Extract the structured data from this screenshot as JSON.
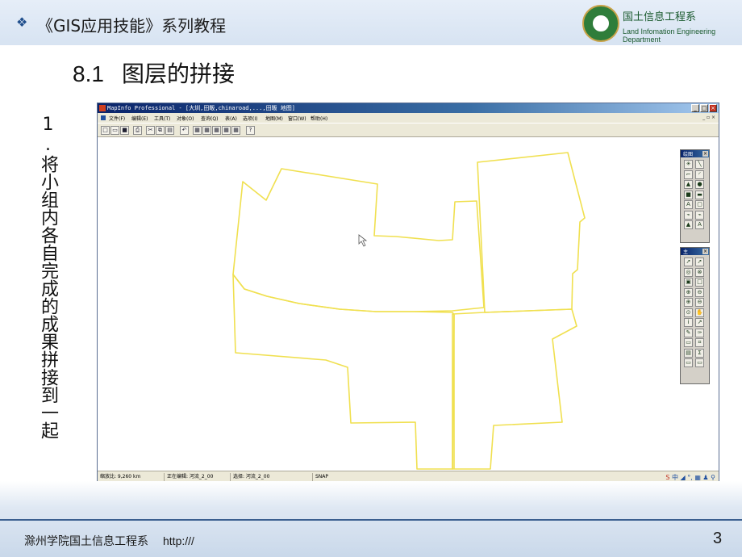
{
  "slide": {
    "header_title": "《GIS应用技能》系列教程",
    "header_bullet": "❖",
    "dept_cn": "国土信息工程系",
    "dept_en": "Land Infomation Engineering Department",
    "section_number": "8.1",
    "section_title": "图层的拼接",
    "vertical_caption": "1.将小组内各自完成的成果拼接到一起",
    "footer_left": "滁州学院国土信息工程系",
    "footer_url": "http:///",
    "page_number": "3",
    "colors": {
      "header_bg": "#d7e3f2",
      "footer_line": "#3b5f8f",
      "logo_green": "#2f7d3a"
    }
  },
  "app": {
    "title": "MapInfo Professional - [大圳,田畈,chinaroad,...,田畈 地图]",
    "menu": [
      "文件(F)",
      "编辑(E)",
      "工具(T)",
      "对象(O)",
      "查询(Q)",
      "表(A)",
      "选项(I)",
      "地图(M)",
      "窗口(W)",
      "帮助(H)"
    ],
    "doc_controls": "_ ▫ ×",
    "window_buttons": {
      "minimize": "_",
      "maximize": "□",
      "close": "×"
    },
    "toolbar_icons": [
      "new-icon",
      "open-icon",
      "save-icon",
      "print-icon",
      "cut-icon",
      "copy-icon",
      "paste-icon",
      "undo-icon",
      "mapper-icon",
      "browser-icon",
      "graph-icon",
      "layout-icon",
      "redistrict-icon",
      "help-icon"
    ],
    "toolbar_glyphs": [
      "□",
      "▭",
      "■",
      "⎙",
      "✂",
      "⧉",
      "▤",
      "↶",
      "▦",
      "▦",
      "▦",
      "▦",
      "▦",
      "?"
    ],
    "drawing_palette": {
      "title": "绘图",
      "icons": [
        "symbol-icon",
        "line-icon",
        "polyline-icon",
        "arc-icon",
        "polygon-icon",
        "ellipse-icon",
        "rectangle-icon",
        "rounded-rect-icon",
        "text-icon",
        "frame-icon",
        "reshape-icon",
        "add-node-icon",
        "region-style-icon",
        "text-style-icon"
      ],
      "glyphs": [
        "✳",
        "╲",
        "⌐",
        "◜",
        "▲",
        "●",
        "■",
        "▬",
        "A",
        "▢",
        "⌁",
        "⌁",
        "▲",
        "A"
      ]
    },
    "main_palette": {
      "title": "主",
      "icons": [
        "select-icon",
        "marquee-icon",
        "radius-select-icon",
        "boundary-select-icon",
        "polygon-select-icon",
        "unselect-icon",
        "graph-select-icon",
        "invert-icon",
        "zoom-in-icon",
        "zoom-out-icon",
        "change-view-icon",
        "grabber-icon",
        "info-icon",
        "hotlink-icon",
        "label-icon",
        "drag-window-icon",
        "layer-control-icon",
        "ruler-icon",
        "legend-icon",
        "statistics-icon",
        "clip-icon",
        "thematic-icon"
      ],
      "glyphs": [
        "➚",
        "➚",
        "◎",
        "⊗",
        "▣",
        "□",
        "⊕",
        "⊖",
        "⊕",
        "⊖",
        "⊙",
        "✋",
        "i",
        "↗",
        "✎",
        "✑",
        "▭",
        "⌗",
        "▤",
        "Σ",
        "▭",
        "▭"
      ]
    },
    "statusbar": {
      "zoom": "缩放比: 9,260 km",
      "editing": "正在编辑: 河流_2_00",
      "selection": "选择: 河流_2_00",
      "snap": "SNAP"
    },
    "ime_first": "S",
    "ime_rest": "中 ◢ °, ▦ ♟ ⚲",
    "map_colors": {
      "region_stroke": "#f0e050",
      "cursor": "#555555"
    }
  }
}
